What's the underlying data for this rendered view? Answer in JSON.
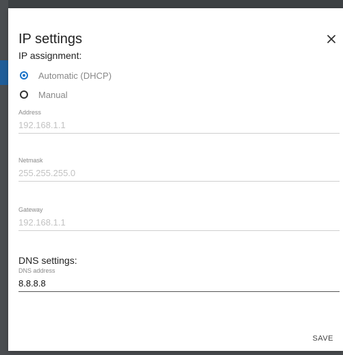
{
  "dialog": {
    "title": "IP settings",
    "close_icon": "close-icon"
  },
  "ip_assignment": {
    "label": "IP assignment:",
    "options": [
      {
        "label": "Automatic (DHCP)",
        "selected": true
      },
      {
        "label": "Manual",
        "selected": false
      }
    ]
  },
  "fields": {
    "address": {
      "label": "Address",
      "value": "192.168.1.1"
    },
    "netmask": {
      "label": "Netmask",
      "value": "255.255.255.0"
    },
    "gateway": {
      "label": "Gateway",
      "value": "192.168.1.1"
    }
  },
  "dns": {
    "heading": "DNS settings:",
    "label": "DNS address",
    "value": "8.8.8.8"
  },
  "actions": {
    "save_label": "SAVE"
  },
  "colors": {
    "accent": "#1a73c8",
    "backdrop": "#4a4d50"
  }
}
